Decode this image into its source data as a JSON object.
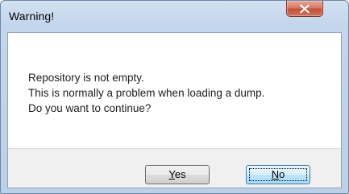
{
  "window": {
    "title": "Warning!",
    "close_icon": "close-icon"
  },
  "message": {
    "lines": [
      "Repository is not empty.",
      "This is normally a problem when loading a dump.",
      "Do you want to continue?"
    ]
  },
  "buttons": {
    "yes": {
      "accel": "Y",
      "rest": "es"
    },
    "no": {
      "accel": "N",
      "rest": "o"
    }
  },
  "colors": {
    "titlebar": "#c4d6ec",
    "close_button": "#c2513c",
    "default_button_border": "#3c7fb1"
  }
}
